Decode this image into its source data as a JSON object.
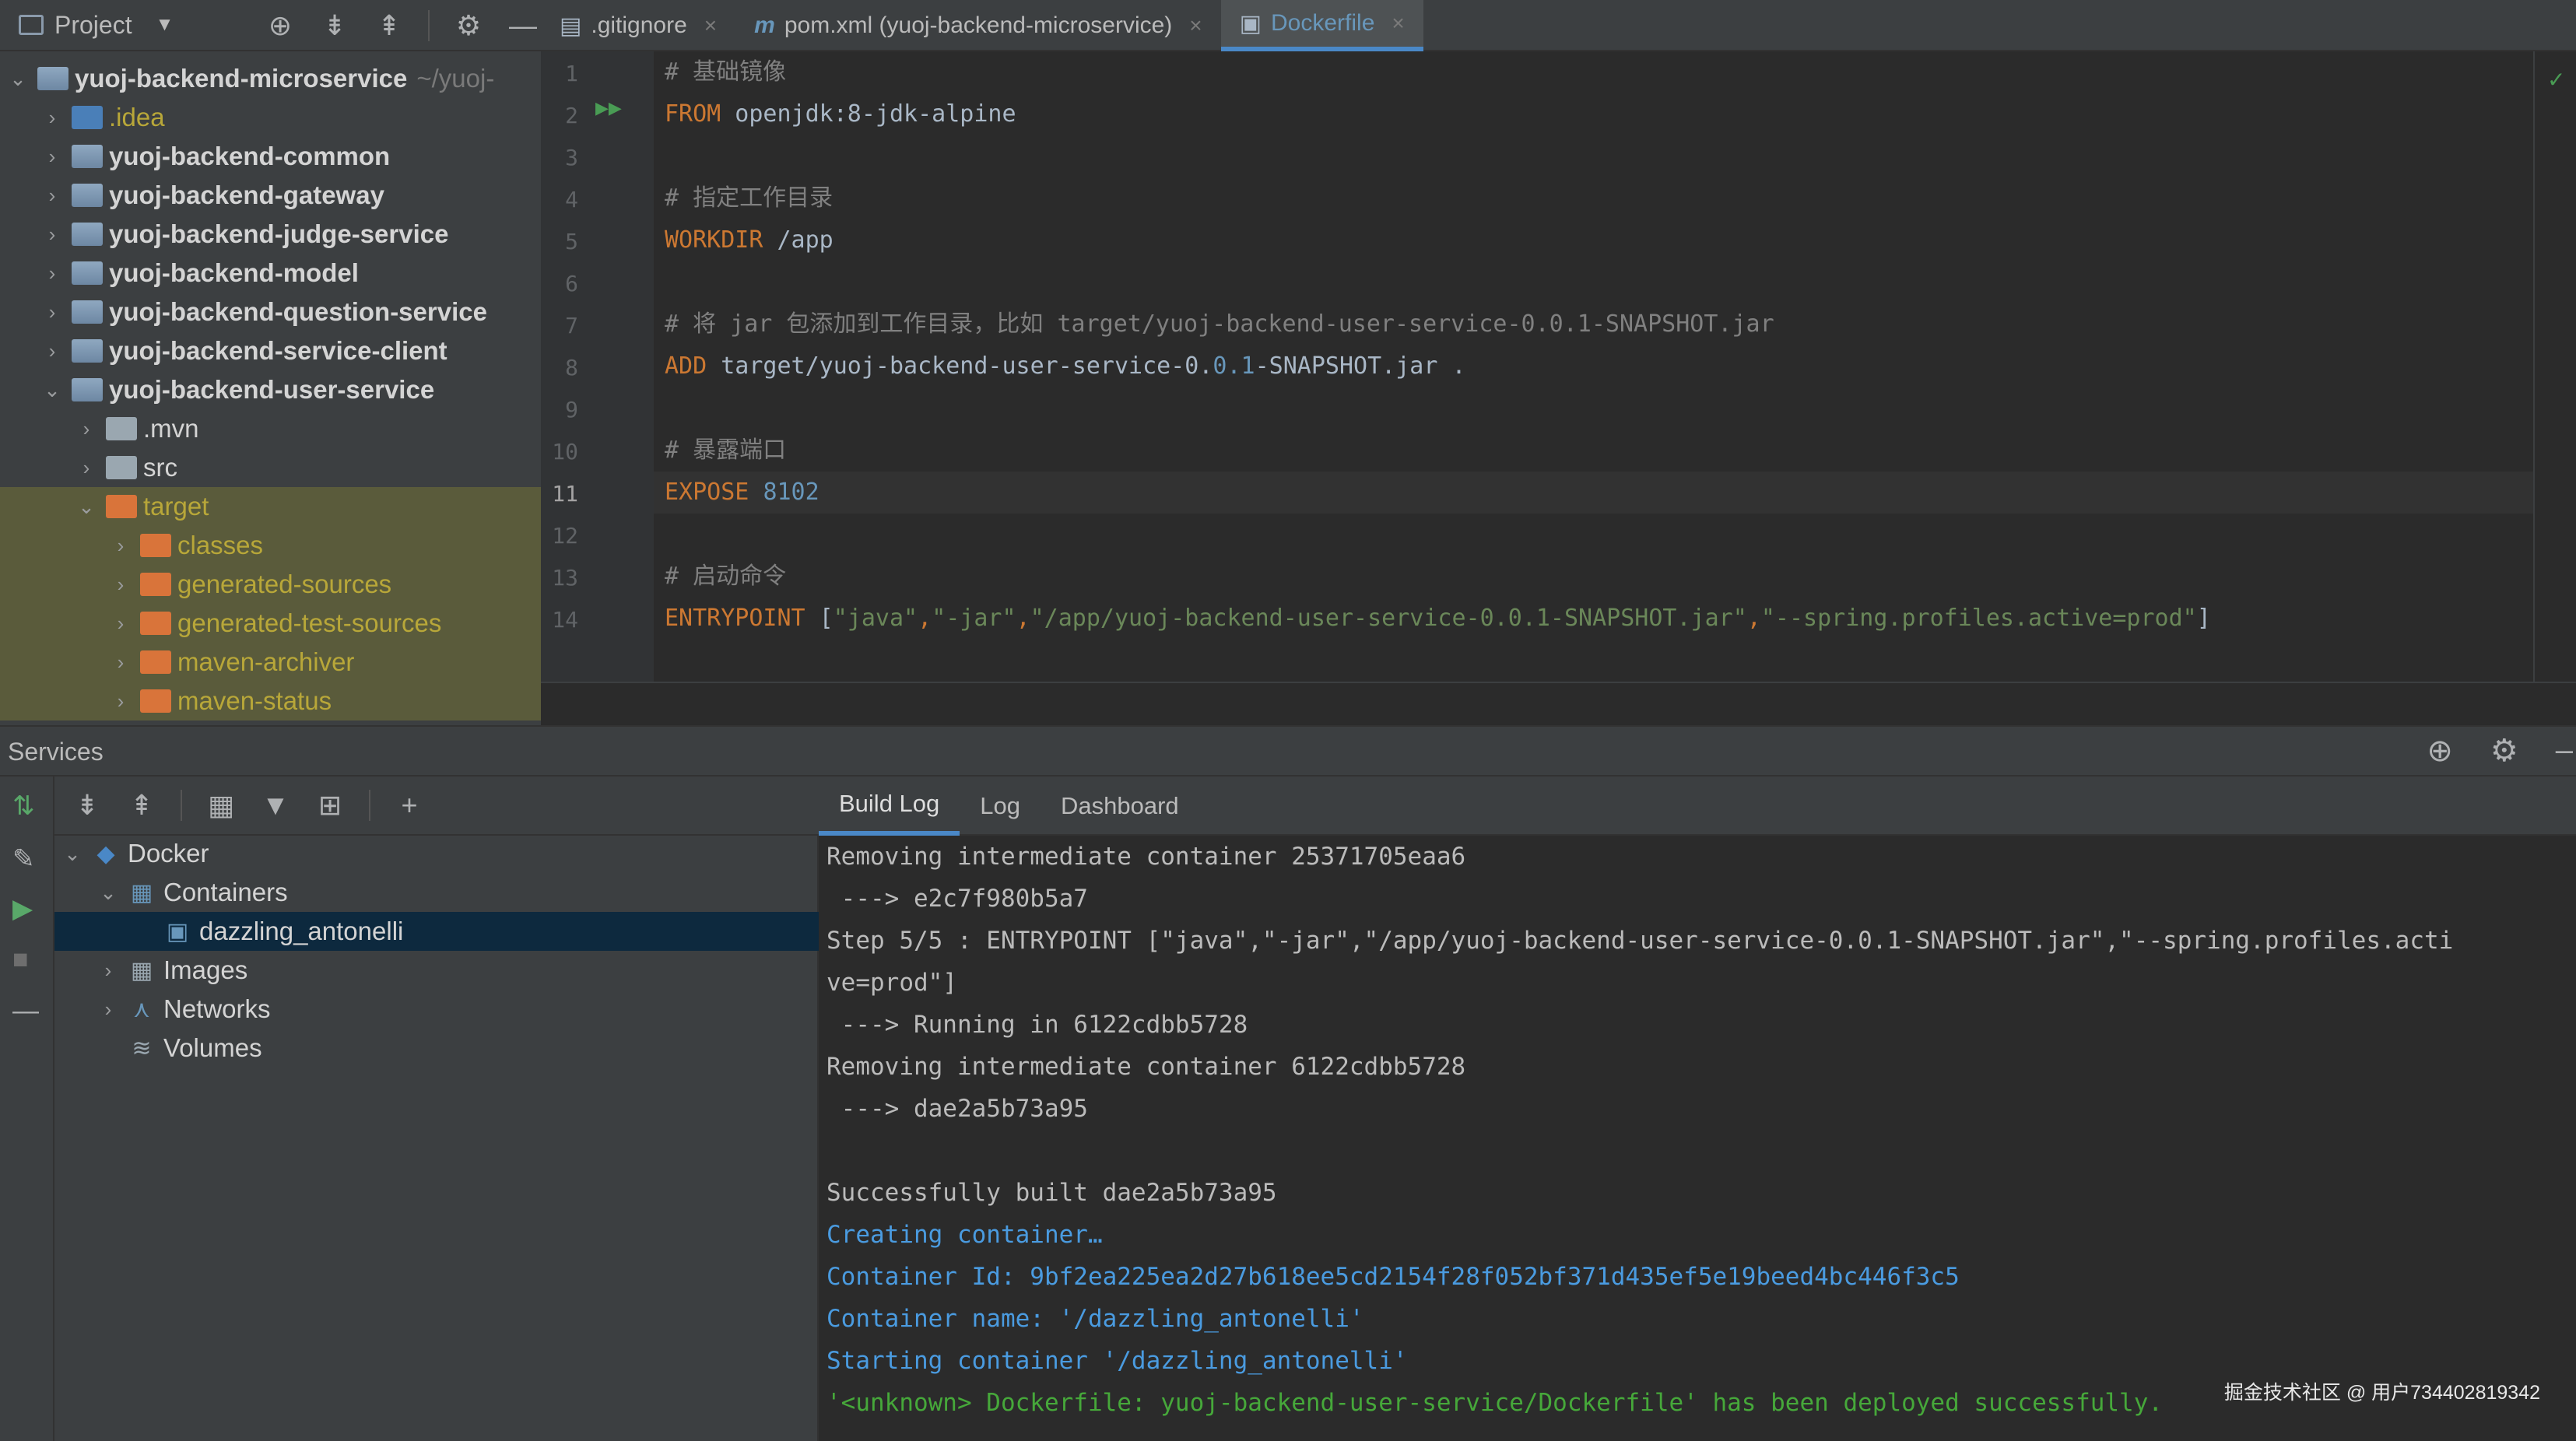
{
  "project_panel": {
    "title": "Project",
    "tree": [
      {
        "label": "yuoj-backend-microservice",
        "hint": "~/yuoj-",
        "depth": 0,
        "expanded": true,
        "kind": "module",
        "style": "bold"
      },
      {
        "label": ".idea",
        "depth": 1,
        "expanded": false,
        "kind": "dir",
        "style": "yellow"
      },
      {
        "label": "yuoj-backend-common",
        "depth": 1,
        "expanded": false,
        "kind": "module",
        "style": "bold"
      },
      {
        "label": "yuoj-backend-gateway",
        "depth": 1,
        "expanded": false,
        "kind": "module",
        "style": "bold"
      },
      {
        "label": "yuoj-backend-judge-service",
        "depth": 1,
        "expanded": false,
        "kind": "module",
        "style": "bold"
      },
      {
        "label": "yuoj-backend-model",
        "depth": 1,
        "expanded": false,
        "kind": "module",
        "style": "bold"
      },
      {
        "label": "yuoj-backend-question-service",
        "depth": 1,
        "expanded": false,
        "kind": "module",
        "style": "bold"
      },
      {
        "label": "yuoj-backend-service-client",
        "depth": 1,
        "expanded": false,
        "kind": "module",
        "style": "bold"
      },
      {
        "label": "yuoj-backend-user-service",
        "depth": 1,
        "expanded": true,
        "kind": "module",
        "style": "bold"
      },
      {
        "label": ".mvn",
        "depth": 2,
        "expanded": false,
        "kind": "dir",
        "style": "plain"
      },
      {
        "label": "src",
        "depth": 2,
        "expanded": false,
        "kind": "dir",
        "style": "plain"
      },
      {
        "label": "target",
        "depth": 2,
        "expanded": true,
        "kind": "dir-orange",
        "style": "yellow"
      },
      {
        "label": "classes",
        "depth": 3,
        "expanded": false,
        "kind": "dir-orange",
        "style": "yellow"
      },
      {
        "label": "generated-sources",
        "depth": 3,
        "expanded": false,
        "kind": "dir-orange",
        "style": "yellow"
      },
      {
        "label": "generated-test-sources",
        "depth": 3,
        "expanded": false,
        "kind": "dir-orange",
        "style": "yellow"
      },
      {
        "label": "maven-archiver",
        "depth": 3,
        "expanded": false,
        "kind": "dir-orange",
        "style": "yellow"
      },
      {
        "label": "maven-status",
        "depth": 3,
        "expanded": false,
        "kind": "dir-orange",
        "style": "yellow"
      }
    ]
  },
  "editor": {
    "tabs": [
      {
        "label": ".gitignore",
        "icon": "git-file-icon",
        "active": false
      },
      {
        "label": "pom.xml (yuoj-backend-microservice)",
        "icon": "maven-file-icon",
        "active": false
      },
      {
        "label": "Dockerfile",
        "icon": "docker-file-icon",
        "active": true
      }
    ],
    "current_line": 11,
    "lines": [
      [
        {
          "t": "# 基础镜像",
          "c": "cmt"
        }
      ],
      [
        {
          "t": "FROM",
          "c": "kw"
        },
        {
          "t": " openjdk:8-jdk-alpine",
          "c": "txt"
        }
      ],
      [],
      [
        {
          "t": "# 指定工作目录",
          "c": "cmt"
        }
      ],
      [
        {
          "t": "WORKDIR",
          "c": "kw"
        },
        {
          "t": " /app",
          "c": "txt"
        }
      ],
      [],
      [
        {
          "t": "# 将 jar 包添加到工作目录，比如 target/yuoj-backend-user-service-0.0.1-SNAPSHOT.jar",
          "c": "cmt"
        }
      ],
      [
        {
          "t": "ADD",
          "c": "kw"
        },
        {
          "t": " target/yuoj-backend-user-service-0.",
          "c": "txt"
        },
        {
          "t": "0.1",
          "c": "num"
        },
        {
          "t": "-SNAPSHOT.jar .",
          "c": "txt"
        }
      ],
      [],
      [
        {
          "t": "# 暴露端口",
          "c": "cmt"
        }
      ],
      [
        {
          "t": "EXPOSE",
          "c": "kw"
        },
        {
          "t": " ",
          "c": "txt"
        },
        {
          "t": "8102",
          "c": "num"
        }
      ],
      [],
      [
        {
          "t": "# 启动命令",
          "c": "cmt"
        }
      ],
      [
        {
          "t": "ENTRYPOINT",
          "c": "kw"
        },
        {
          "t": " [",
          "c": "txt"
        },
        {
          "t": "\"java\"",
          "c": "str"
        },
        {
          "t": ",",
          "c": "kw"
        },
        {
          "t": "\"-jar\"",
          "c": "str"
        },
        {
          "t": ",",
          "c": "kw"
        },
        {
          "t": "\"/app/yuoj-backend-user-service-0.0.1-SNAPSHOT.jar\"",
          "c": "str"
        },
        {
          "t": ",",
          "c": "kw"
        },
        {
          "t": "\"--spring.profiles.active=prod\"",
          "c": "str"
        },
        {
          "t": "]",
          "c": "txt"
        }
      ]
    ]
  },
  "services": {
    "title": "Services",
    "tree": [
      {
        "label": "Docker",
        "depth": 0,
        "chev": "down",
        "icon": "docker-whale-icon",
        "selected": false
      },
      {
        "label": "Containers",
        "depth": 1,
        "chev": "down",
        "icon": "containers-icon",
        "selected": false
      },
      {
        "label": "dazzling_antonelli",
        "depth": 2,
        "chev": "",
        "icon": "container-icon",
        "selected": true
      },
      {
        "label": "Images",
        "depth": 1,
        "chev": "right",
        "icon": "images-icon",
        "selected": false
      },
      {
        "label": "Networks",
        "depth": 1,
        "chev": "right",
        "icon": "network-icon",
        "selected": false
      },
      {
        "label": "Volumes",
        "depth": 1,
        "chev": "",
        "icon": "volumes-icon",
        "selected": false
      }
    ],
    "log_tabs": [
      {
        "label": "Build Log",
        "active": true
      },
      {
        "label": "Log",
        "active": false
      },
      {
        "label": "Dashboard",
        "active": false
      }
    ],
    "log_lines": [
      {
        "t": "Removing intermediate container 25371705eaa6",
        "c": ""
      },
      {
        "t": " ---> e2c7f980b5a7",
        "c": ""
      },
      {
        "t": "Step 5/5 : ENTRYPOINT [\"java\",\"-jar\",\"/app/yuoj-backend-user-service-0.0.1-SNAPSHOT.jar\",\"--spring.profiles.acti",
        "c": ""
      },
      {
        "t": "ve=prod\"]",
        "c": ""
      },
      {
        "t": " ---> Running in 6122cdbb5728",
        "c": ""
      },
      {
        "t": "Removing intermediate container 6122cdbb5728",
        "c": ""
      },
      {
        "t": " ---> dae2a5b73a95",
        "c": ""
      },
      {
        "t": "",
        "c": ""
      },
      {
        "t": "Successfully built dae2a5b73a95",
        "c": ""
      },
      {
        "t": "Creating container…",
        "c": "info"
      },
      {
        "t": "Container Id: 9bf2ea225ea2d27b618ee5cd2154f28f052bf371d435ef5e19beed4bc446f3c5",
        "c": "info"
      },
      {
        "t": "Container name: '/dazzling_antonelli'",
        "c": "info"
      },
      {
        "t": "Starting container '/dazzling_antonelli'",
        "c": "info"
      },
      {
        "t": "'<unknown> Dockerfile: yuoj-backend-user-service/Dockerfile' has been deployed successfully.",
        "c": "succ"
      }
    ]
  },
  "watermark": "掘金技术社区 @ 用户734402819342"
}
